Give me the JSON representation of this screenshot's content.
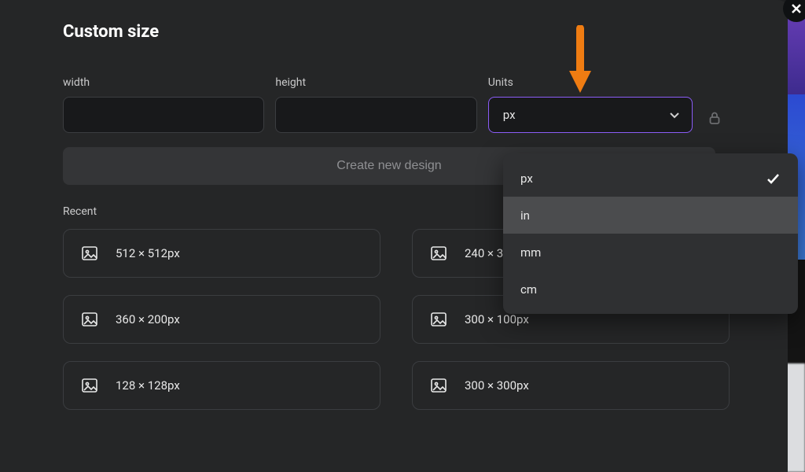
{
  "title": "Custom size",
  "fields": {
    "width_label": "width",
    "height_label": "height",
    "units_label": "Units",
    "width_value": "",
    "height_value": "",
    "units_selected": "px"
  },
  "create_button_label": "Create new design",
  "recent_label": "Recent",
  "recent": [
    {
      "label": "512 × 512px"
    },
    {
      "label": "240 × 3"
    },
    {
      "label": "360 × 200px"
    },
    {
      "label": "300 × 100px"
    },
    {
      "label": "128 × 128px"
    },
    {
      "label": "300 × 300px"
    }
  ],
  "units_dropdown": {
    "options": [
      {
        "value": "px",
        "selected": true,
        "hovered": false
      },
      {
        "value": "in",
        "selected": false,
        "hovered": true
      },
      {
        "value": "mm",
        "selected": false,
        "hovered": false
      },
      {
        "value": "cm",
        "selected": false,
        "hovered": false
      }
    ]
  },
  "icons": {
    "chevron_down": "chevron-down-icon",
    "lock": "lock-icon",
    "image": "image-icon",
    "check": "check-icon",
    "close": "close-icon"
  },
  "colors": {
    "accent": "#8b5cf6",
    "panel": "#252627",
    "input_bg": "#18191b",
    "dropdown_bg": "#2f3032",
    "border": "#3b3d40"
  }
}
